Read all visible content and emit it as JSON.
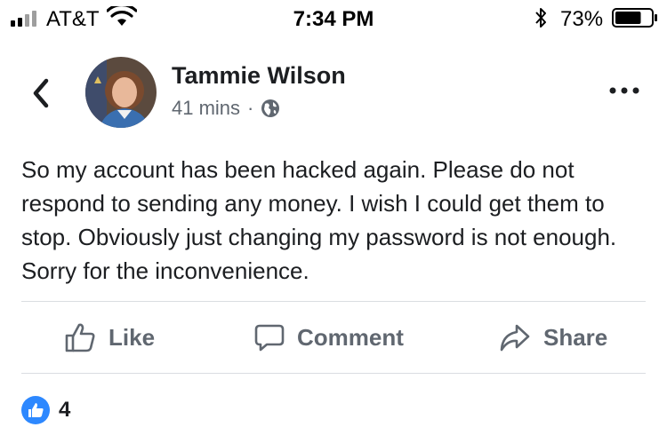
{
  "status_bar": {
    "carrier": "AT&T",
    "time": "7:34 PM",
    "battery_percent": "73%",
    "battery_level": 0.73,
    "icons": [
      "signal-icon",
      "wifi-icon",
      "bluetooth-icon",
      "battery-icon"
    ]
  },
  "post": {
    "author": "Tammie Wilson",
    "time_ago": "41 mins",
    "separator": "·",
    "privacy_icon": "globe-icon",
    "text": "So my account has been hacked again. Please do not respond to sending any money. I wish I could get them to stop. Obviously just changing my password is not enough. Sorry for the inconvenience."
  },
  "actions": {
    "like": "Like",
    "comment": "Comment",
    "share": "Share"
  },
  "reactions": {
    "count": "4",
    "icon": "like-reaction-icon"
  },
  "colors": {
    "text": "#1c1e21",
    "secondary_text": "#606770",
    "divider": "#dadde1",
    "like_blue": "#2d88ff"
  }
}
